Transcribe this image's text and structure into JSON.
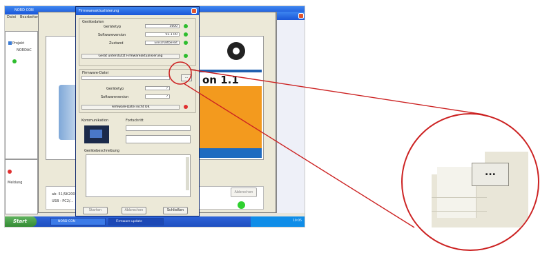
{
  "desktop": {
    "back_window_title": "NORD CON",
    "menu_items": [
      "Datei",
      "Bearbeiten"
    ],
    "tree": [
      "Projekt",
      "NORDAC"
    ],
    "lower_panel": [
      "Meldung"
    ],
    "lower_texts": [
      "ab: 51/SK200E",
      "USB - PC2/..."
    ],
    "right_button": "Abbrechen"
  },
  "splash": {
    "version_text": "on 1.1"
  },
  "dialog": {
    "title": "Firmwareaktualisierung",
    "group_device": "Gerätedaten",
    "rows": [
      {
        "label": "Gerätetyp",
        "value": "5600"
      },
      {
        "label": "Softwareversion",
        "value": "V2.1 R0"
      },
      {
        "label": "Zustand",
        "value": "Einschaltbereit"
      }
    ],
    "device_status": "Gerät unterstützt Firmwareaktualisierung",
    "group_file": "Firmware-Datei",
    "file_rows": [
      {
        "label": "Gerätetyp",
        "value": "?"
      },
      {
        "label": "Softwareversion",
        "value": "?"
      }
    ],
    "file_status": "Firmware-Datei nicht OK",
    "browse_button": "...",
    "group_comm": "Kommunikation",
    "group_fortschritt": "Fortschritt",
    "group_desc": "Gerätebeschreibung",
    "buttons": {
      "start": "Starten",
      "abort": "Abbrechen",
      "close": "Schließen"
    }
  },
  "taskbar": {
    "start": "Start",
    "tasks": [
      "NORD CON",
      "Firmware update"
    ],
    "clock": "10:05"
  },
  "zoom": {
    "button_label": "..."
  },
  "colors": {
    "callout": "#cc2222",
    "led_ok": "#2ebd2e",
    "led_error": "#e03030",
    "splash_orange": "#f39a1e"
  }
}
